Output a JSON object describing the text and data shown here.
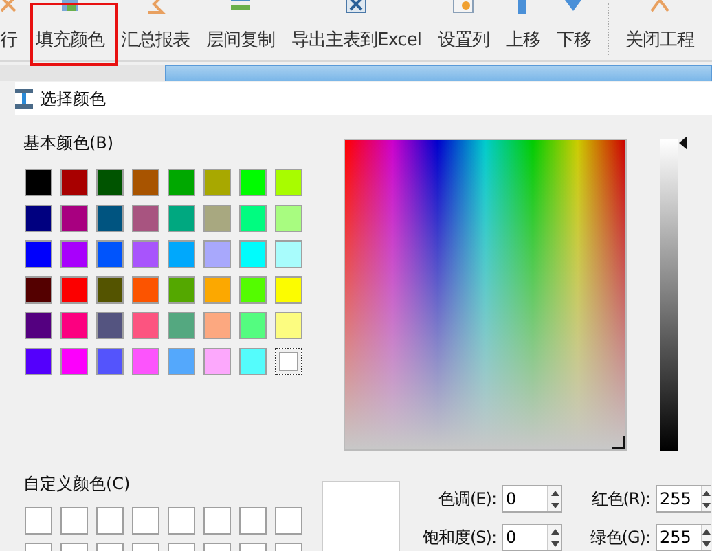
{
  "toolbar": {
    "items": [
      {
        "label": "行",
        "highlighted": false
      },
      {
        "label": "填充颜色",
        "highlighted": true
      },
      {
        "label": "汇总报表",
        "highlighted": false
      },
      {
        "label": "层间复制",
        "highlighted": false
      },
      {
        "label": "导出主表到Excel",
        "highlighted": false
      },
      {
        "label": "设置列",
        "highlighted": false
      },
      {
        "label": "上移",
        "highlighted": false
      },
      {
        "label": "下移",
        "highlighted": false
      },
      {
        "label": "关闭工程",
        "highlighted": false
      }
    ]
  },
  "dialog": {
    "title": "选择颜色",
    "basic_colors_label": "基本颜色(B)",
    "basic_colors": [
      {
        "color": "#000000",
        "selected": false
      },
      {
        "color": "#a80000",
        "selected": false
      },
      {
        "color": "#005400",
        "selected": false
      },
      {
        "color": "#a85400",
        "selected": false
      },
      {
        "color": "#00a800",
        "selected": false
      },
      {
        "color": "#a8a800",
        "selected": false
      },
      {
        "color": "#00fc00",
        "selected": false
      },
      {
        "color": "#a8fc00",
        "selected": false
      },
      {
        "color": "#000080",
        "selected": false
      },
      {
        "color": "#a80080",
        "selected": false
      },
      {
        "color": "#005480",
        "selected": false
      },
      {
        "color": "#a85480",
        "selected": false
      },
      {
        "color": "#00a880",
        "selected": false
      },
      {
        "color": "#a8a880",
        "selected": false
      },
      {
        "color": "#00fc80",
        "selected": false
      },
      {
        "color": "#a8fc80",
        "selected": false
      },
      {
        "color": "#0000fc",
        "selected": false
      },
      {
        "color": "#a800fc",
        "selected": false
      },
      {
        "color": "#0054fc",
        "selected": false
      },
      {
        "color": "#a854fc",
        "selected": false
      },
      {
        "color": "#00a8fc",
        "selected": false
      },
      {
        "color": "#a8a8fc",
        "selected": false
      },
      {
        "color": "#00fcfc",
        "selected": false
      },
      {
        "color": "#a8fcfc",
        "selected": false
      },
      {
        "color": "#540000",
        "selected": false
      },
      {
        "color": "#fc0000",
        "selected": false
      },
      {
        "color": "#545400",
        "selected": false
      },
      {
        "color": "#fc5400",
        "selected": false
      },
      {
        "color": "#54a800",
        "selected": false
      },
      {
        "color": "#fca800",
        "selected": false
      },
      {
        "color": "#54fc00",
        "selected": false
      },
      {
        "color": "#fcfc00",
        "selected": false
      },
      {
        "color": "#540080",
        "selected": false
      },
      {
        "color": "#fc0080",
        "selected": false
      },
      {
        "color": "#545480",
        "selected": false
      },
      {
        "color": "#fc5480",
        "selected": false
      },
      {
        "color": "#54a880",
        "selected": false
      },
      {
        "color": "#fca880",
        "selected": false
      },
      {
        "color": "#54fc80",
        "selected": false
      },
      {
        "color": "#fcfc80",
        "selected": false
      },
      {
        "color": "#5400fc",
        "selected": false
      },
      {
        "color": "#fc00fc",
        "selected": false
      },
      {
        "color": "#5454fc",
        "selected": false
      },
      {
        "color": "#fc54fc",
        "selected": false
      },
      {
        "color": "#54a8fc",
        "selected": false
      },
      {
        "color": "#fca8fc",
        "selected": false
      },
      {
        "color": "#54fcfc",
        "selected": false
      },
      {
        "color": "#ffffff",
        "selected": true
      }
    ],
    "custom_colors_label": "自定义颜色(C)",
    "fields": [
      {
        "label": "色调(E):",
        "value": "0"
      },
      {
        "label": "红色(R):",
        "value": "255"
      },
      {
        "label": "饱和度(S):",
        "value": "0"
      },
      {
        "label": "绿色(G):",
        "value": "255"
      }
    ]
  }
}
